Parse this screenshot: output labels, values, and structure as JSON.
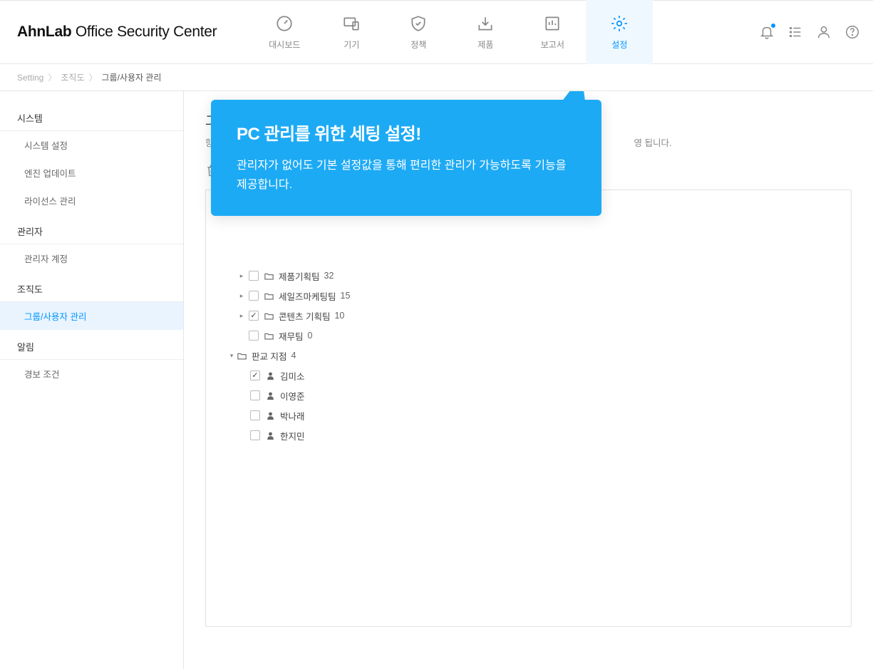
{
  "logo": {
    "bold": "AhnLab",
    "rest": " Office Security Center"
  },
  "nav": {
    "dashboard": "대시보드",
    "device": "기기",
    "policy": "정책",
    "product": "제품",
    "report": "보고서",
    "settings": "설정"
  },
  "breadcrumb": {
    "p1": "Setting",
    "p2": "조직도",
    "p3": "그룹/사용자 관리"
  },
  "sidebar": {
    "system": {
      "head": "시스템",
      "items": [
        "시스템 설정",
        "엔진 업데이트",
        "라이선스 관리"
      ]
    },
    "admin": {
      "head": "관리자",
      "items": [
        "관리자 계정"
      ]
    },
    "org": {
      "head": "조직도",
      "items": [
        "그룹/사용자 관리"
      ]
    },
    "alert": {
      "head": "알림",
      "items": [
        "경보 조건"
      ]
    }
  },
  "main": {
    "title_prefix": "그룹/",
    "desc_prefix": "항목을",
    "desc_suffix": "영 됩니다."
  },
  "tree": {
    "nodes": [
      {
        "label": "제품기획팀",
        "count": "32"
      },
      {
        "label": "세일즈마케팅팀",
        "count": "15"
      },
      {
        "label": "콘텐츠 기획팀",
        "count": "10"
      },
      {
        "label": "재무팀",
        "count": "0"
      }
    ],
    "branch": {
      "label": "판교 지점",
      "count": "4"
    },
    "users": [
      "김미소",
      "이영준",
      "박나래",
      "한지민"
    ]
  },
  "tooltip": {
    "title": "PC 관리를 위한 세팅 설정!",
    "body": "관리자가 없어도 기본 설정값을 통해 편리한 관리가 가능하도록 기능을 제공합니다."
  }
}
